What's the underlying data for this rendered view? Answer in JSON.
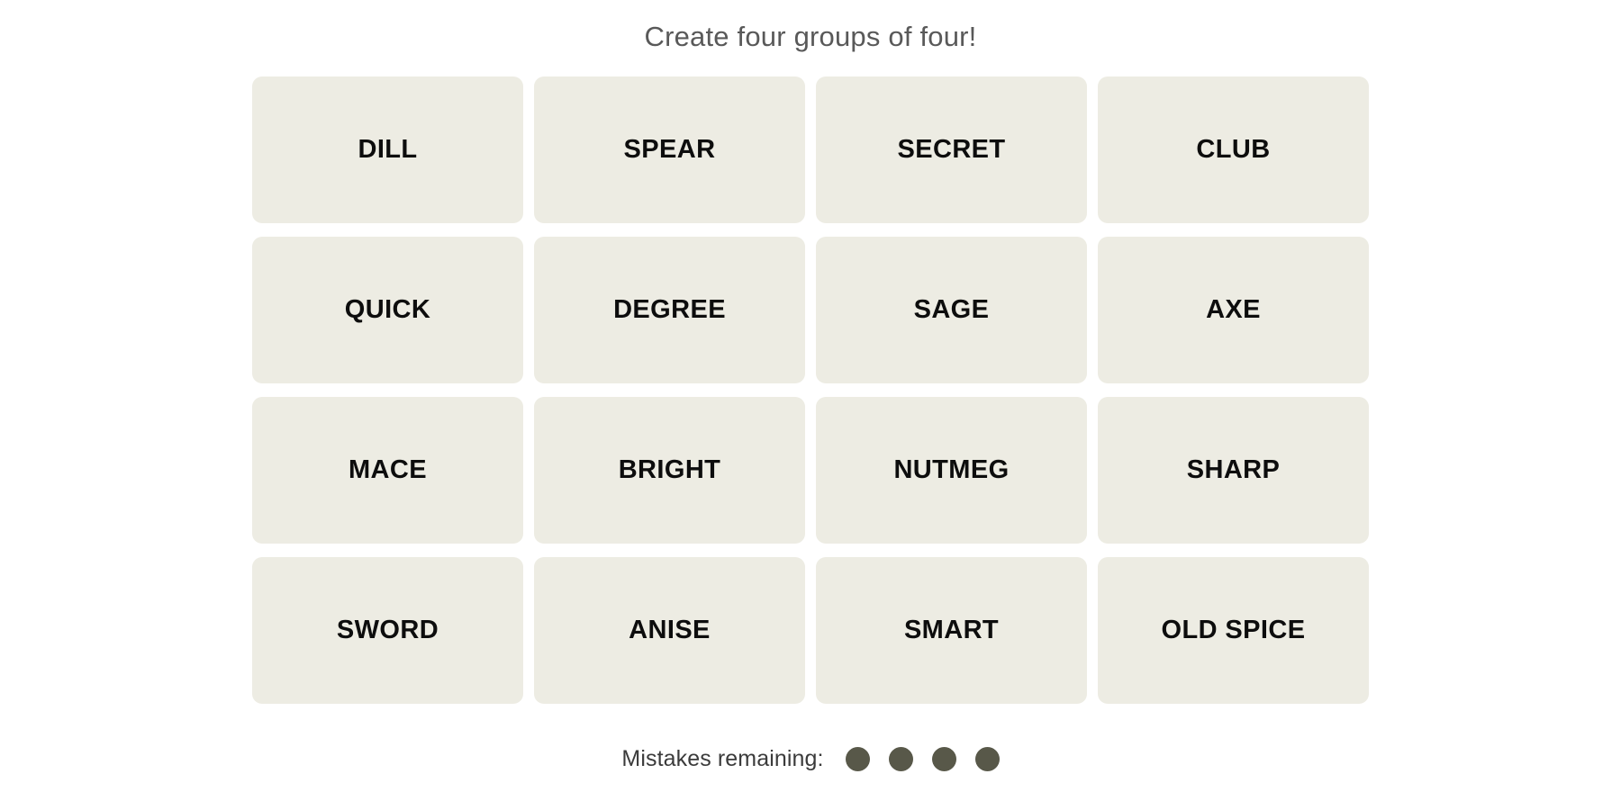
{
  "header": {
    "instruction": "Create four groups of four!"
  },
  "board": {
    "rows": [
      [
        {
          "word": "DILL"
        },
        {
          "word": "SPEAR"
        },
        {
          "word": "SECRET"
        },
        {
          "word": "CLUB"
        }
      ],
      [
        {
          "word": "QUICK"
        },
        {
          "word": "DEGREE"
        },
        {
          "word": "SAGE"
        },
        {
          "word": "AXE"
        }
      ],
      [
        {
          "word": "MACE"
        },
        {
          "word": "BRIGHT"
        },
        {
          "word": "NUTMEG"
        },
        {
          "word": "SHARP"
        }
      ],
      [
        {
          "word": "SWORD"
        },
        {
          "word": "ANISE"
        },
        {
          "word": "SMART"
        },
        {
          "word": "OLD SPICE"
        }
      ]
    ]
  },
  "footer": {
    "mistakes_label": "Mistakes remaining:",
    "mistakes_remaining": 4,
    "dots": [
      1,
      2,
      3,
      4
    ]
  },
  "colors": {
    "page_background": "#ffffff",
    "tile_background": "#edece3",
    "tile_text": "#0d0d0d",
    "instruction_text": "#595959",
    "mistakes_text": "#3b3b3b",
    "mistake_dot": "#585849"
  }
}
